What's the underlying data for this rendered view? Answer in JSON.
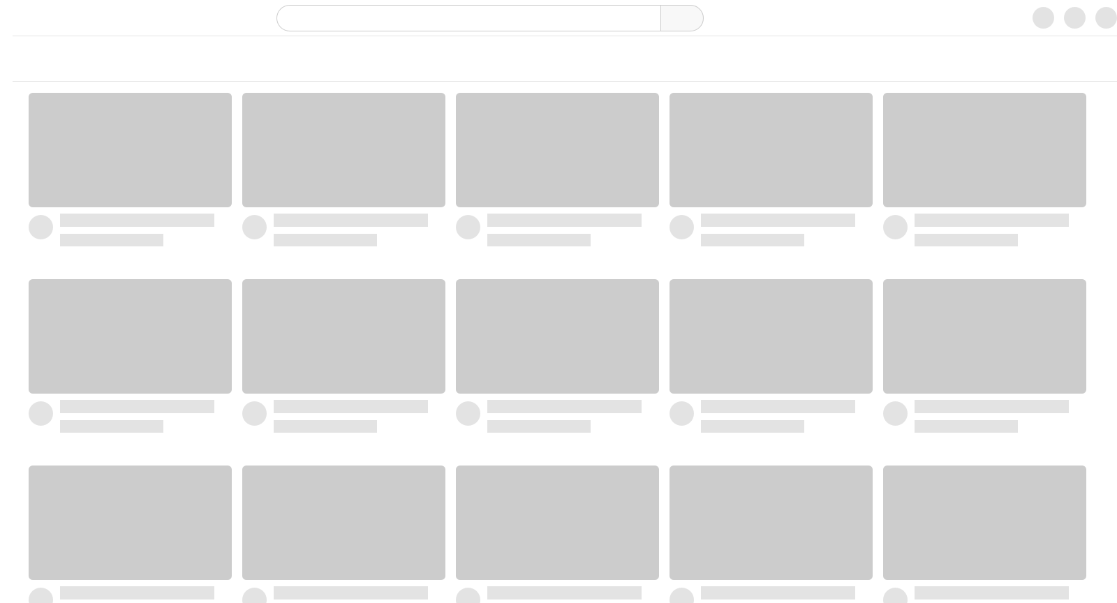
{
  "search": {
    "value": "",
    "placeholder": ""
  },
  "header": {
    "actions": [
      "avatar-placeholder",
      "avatar-placeholder",
      "avatar-placeholder"
    ]
  },
  "grid": {
    "state": "loading",
    "rows": 3,
    "columns": 5,
    "placeholder_count": 15
  },
  "colors": {
    "thumbnail_placeholder": "#cccccc",
    "line_placeholder": "#e3e3e3",
    "divider": "#e4e4e4",
    "background": "#ffffff"
  }
}
